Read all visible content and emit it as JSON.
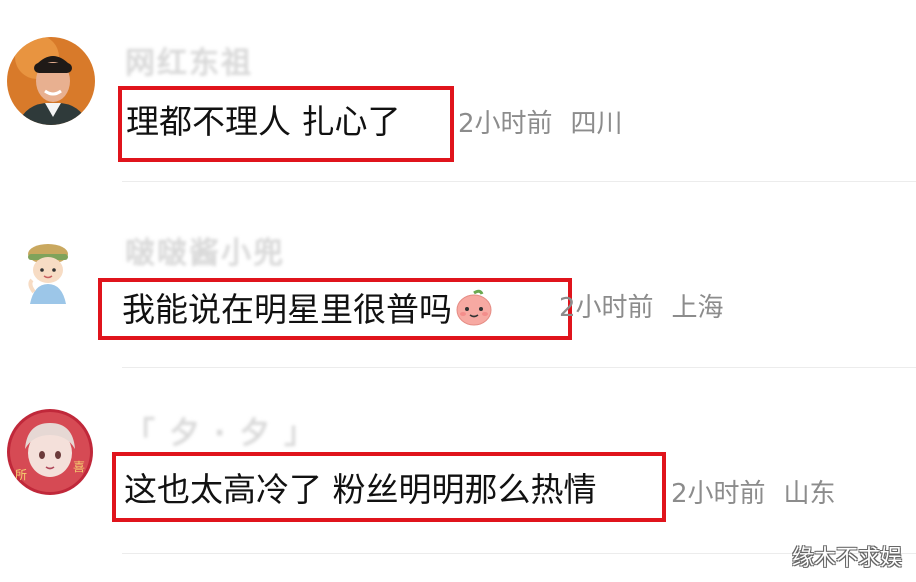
{
  "comments": [
    {
      "username": "网红东祖",
      "text": "理都不理人 扎心了",
      "time": "2小时前",
      "location": "四川",
      "avatar_icon": "man-portrait-avatar"
    },
    {
      "username": "啵啵酱小兜",
      "text": "我能说在明星里很普吗",
      "emoji": "peach-smile-emoji",
      "time": "2小时前",
      "location": "上海",
      "avatar_icon": "cartoon-hat-avatar"
    },
    {
      "username": "「 夕 · 夕 」",
      "text": "这也太高冷了 粉丝明明那么热情",
      "time": "2小时前",
      "location": "山东",
      "avatar_icon": "anime-girl-avatar"
    }
  ],
  "watermark": "缘木不求娱",
  "colors": {
    "highlight": "#e0141c",
    "meta_text": "#8c8c8c",
    "comment_text": "#111111"
  }
}
